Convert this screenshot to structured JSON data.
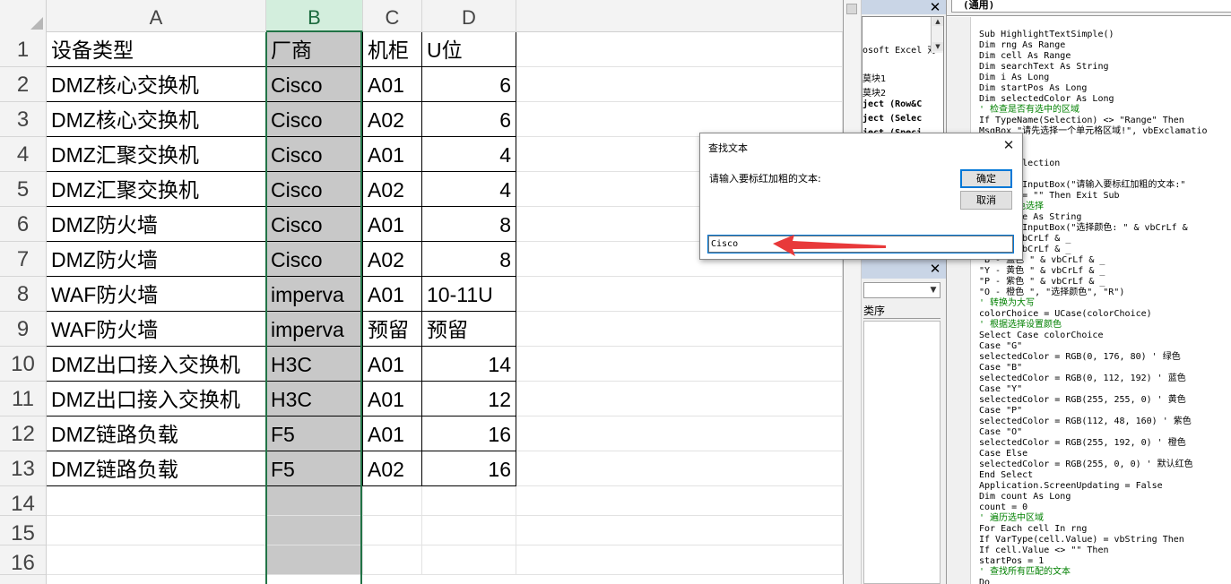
{
  "sheet": {
    "columns": [
      "A",
      "B",
      "C",
      "D"
    ],
    "rows": [
      "1",
      "2",
      "3",
      "4",
      "5",
      "6",
      "7",
      "8",
      "9",
      "10",
      "11",
      "12",
      "13",
      "14",
      "15",
      "16"
    ],
    "header_row": {
      "a": "设备类型",
      "b": "厂商",
      "c": "机柜",
      "d": "U位"
    },
    "data": [
      {
        "a": "DMZ核心交换机",
        "b": "Cisco",
        "c": "A01",
        "d": "6"
      },
      {
        "a": "DMZ核心交换机",
        "b": "Cisco",
        "c": "A02",
        "d": "6"
      },
      {
        "a": "DMZ汇聚交换机",
        "b": "Cisco",
        "c": "A01",
        "d": "4"
      },
      {
        "a": "DMZ汇聚交换机",
        "b": "Cisco",
        "c": "A02",
        "d": "4"
      },
      {
        "a": "DMZ防火墙",
        "b": "Cisco",
        "c": "A01",
        "d": "8"
      },
      {
        "a": "DMZ防火墙",
        "b": "Cisco",
        "c": "A02",
        "d": "8"
      },
      {
        "a": "WAF防火墙",
        "b": "imperva",
        "c": "A01",
        "d": "10-11U"
      },
      {
        "a": "WAF防火墙",
        "b": "imperva",
        "c": "预留",
        "d": "预留"
      },
      {
        "a": "DMZ出口接入交换机",
        "b": "H3C",
        "c": "A01",
        "d": "14"
      },
      {
        "a": "DMZ出口接入交换机",
        "b": "H3C",
        "c": "A01",
        "d": "12"
      },
      {
        "a": "DMZ链路负载",
        "b": "F5",
        "c": "A01",
        "d": "16"
      },
      {
        "a": "DMZ链路负载",
        "b": "F5",
        "c": "A02",
        "d": "16"
      }
    ],
    "selected_column": "B",
    "accent_color": "#217346",
    "selection_fill": "#c8c8c8"
  },
  "project": {
    "tree_lines": [
      "osoft Excel 对",
      "",
      "莫块1",
      "莫块2",
      "ject (Row&C",
      "ject (Selec",
      "ject (Speci"
    ],
    "props_tab": "类序"
  },
  "code": {
    "proc_combo": "(通用)",
    "lines": [
      {
        "t": "Sub HighlightTextSimple()",
        "c": false
      },
      {
        "t": "Dim rng As Range",
        "c": false
      },
      {
        "t": "Dim cell As Range",
        "c": false
      },
      {
        "t": "Dim searchText As String",
        "c": false
      },
      {
        "t": "Dim i As Long",
        "c": false
      },
      {
        "t": "Dim startPos As Long",
        "c": false
      },
      {
        "t": "Dim selectedColor As Long",
        "c": false
      },
      {
        "t": "' 检查是否有选中的区域",
        "c": true
      },
      {
        "t": "If TypeName(Selection) <> \"Range\" Then",
        "c": false
      },
      {
        "t": "MsgBox \"请先选择一个单元格区域!\", vbExclamatio",
        "c": false
      },
      {
        "t": "",
        "c": false
      },
      {
        "t": "",
        "c": false
      },
      {
        "t": "    = Selection",
        "c": false
      },
      {
        "t": "  索文本",
        "c": true
      },
      {
        "t": "  ext = InputBox(\"请输入要标红加粗的文本:\"",
        "c": false
      },
      {
        "t": "  hText = \"\" Then Exit Sub",
        "c": false
      },
      {
        "t": "  单的颜色选择",
        "c": true
      },
      {
        "t": "  rChoice As String",
        "c": false
      },
      {
        "t": "  ice = InputBox(\"选择颜色: \" & vbCrLf &",
        "c": false
      },
      {
        "t": "   \" & vbCrLf & _",
        "c": false
      },
      {
        "t": "   \" & vbCrLf & _",
        "c": false
      },
      {
        "t": "\"B - 蓝色 \" & vbCrLf & _",
        "c": false
      },
      {
        "t": "\"Y - 黄色 \" & vbCrLf & _",
        "c": false
      },
      {
        "t": "\"P - 紫色 \" & vbCrLf & _",
        "c": false
      },
      {
        "t": "\"O - 橙色 \", \"选择颜色\", \"R\")",
        "c": false
      },
      {
        "t": "' 转换为大写",
        "c": true
      },
      {
        "t": "colorChoice = UCase(colorChoice)",
        "c": false
      },
      {
        "t": "' 根据选择设置颜色",
        "c": true
      },
      {
        "t": "Select Case colorChoice",
        "c": false
      },
      {
        "t": "Case \"G\"",
        "c": false
      },
      {
        "t": "selectedColor = RGB(0, 176, 80) ' 绿色",
        "c": false
      },
      {
        "t": "Case \"B\"",
        "c": false
      },
      {
        "t": "selectedColor = RGB(0, 112, 192) ' 蓝色",
        "c": false
      },
      {
        "t": "Case \"Y\"",
        "c": false
      },
      {
        "t": "selectedColor = RGB(255, 255, 0) ' 黄色",
        "c": false
      },
      {
        "t": "Case \"P\"",
        "c": false
      },
      {
        "t": "selectedColor = RGB(112, 48, 160) ' 紫色",
        "c": false
      },
      {
        "t": "Case \"O\"",
        "c": false
      },
      {
        "t": "selectedColor = RGB(255, 192, 0) ' 橙色",
        "c": false
      },
      {
        "t": "Case Else",
        "c": false
      },
      {
        "t": "selectedColor = RGB(255, 0, 0) ' 默认红色",
        "c": false
      },
      {
        "t": "End Select",
        "c": false
      },
      {
        "t": "Application.ScreenUpdating = False",
        "c": false
      },
      {
        "t": "Dim count As Long",
        "c": false
      },
      {
        "t": "count = 0",
        "c": false
      },
      {
        "t": "' 遍历选中区域",
        "c": true
      },
      {
        "t": "For Each cell In rng",
        "c": false
      },
      {
        "t": "If VarType(cell.Value) = vbString Then",
        "c": false
      },
      {
        "t": "If cell.Value <> \"\" Then",
        "c": false
      },
      {
        "t": "startPos = 1",
        "c": false
      },
      {
        "t": "' 查找所有匹配的文本",
        "c": true
      },
      {
        "t": "Do",
        "c": false
      }
    ]
  },
  "dialog": {
    "title": "查找文本",
    "prompt": "请输入要标红加粗的文本:",
    "ok_label": "确定",
    "cancel_label": "取消",
    "input_value": "Cisco",
    "arrow_color": "#e8393a"
  }
}
